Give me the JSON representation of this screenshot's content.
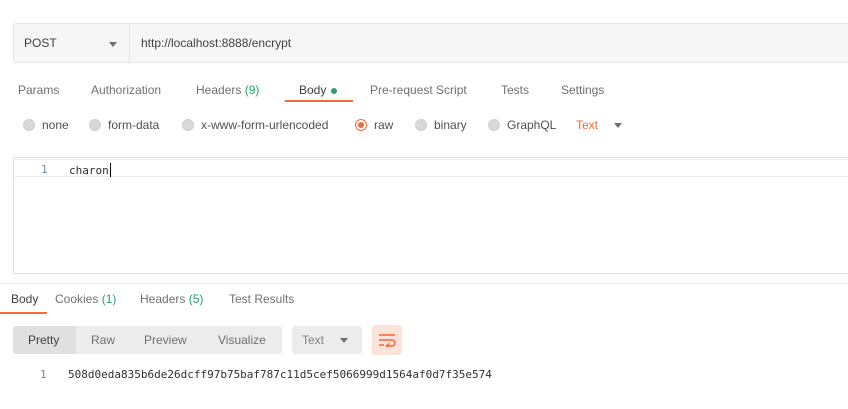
{
  "request": {
    "method": "POST",
    "url": "http://localhost:8888/encrypt"
  },
  "request_tabs": [
    {
      "label": "Params"
    },
    {
      "label": "Authorization"
    },
    {
      "label": "Headers",
      "count": "(9)"
    },
    {
      "label": "Body",
      "active": true
    },
    {
      "label": "Pre-request Script"
    },
    {
      "label": "Tests"
    },
    {
      "label": "Settings"
    }
  ],
  "body_types": [
    {
      "label": "none"
    },
    {
      "label": "form-data"
    },
    {
      "label": "x-www-form-urlencoded"
    },
    {
      "label": "raw",
      "selected": true
    },
    {
      "label": "binary"
    },
    {
      "label": "GraphQL"
    }
  ],
  "raw_language": "Text",
  "editor": {
    "line_number": "1",
    "content": "charon"
  },
  "response_tabs": [
    {
      "label": "Body",
      "active": true
    },
    {
      "label": "Cookies",
      "count": "(1)"
    },
    {
      "label": "Headers",
      "count": "(5)"
    },
    {
      "label": "Test Results"
    }
  ],
  "response_views": [
    "Pretty",
    "Raw",
    "Preview",
    "Visualize"
  ],
  "response_format": "Text",
  "response_body": {
    "line_number": "1",
    "content": "508d0eda835b6de26dcff97b75baf787c11d5cef5066999d1564af0d7f35e574"
  },
  "colors": {
    "accent": "#f26b3a",
    "count_green": "#26a26a"
  }
}
